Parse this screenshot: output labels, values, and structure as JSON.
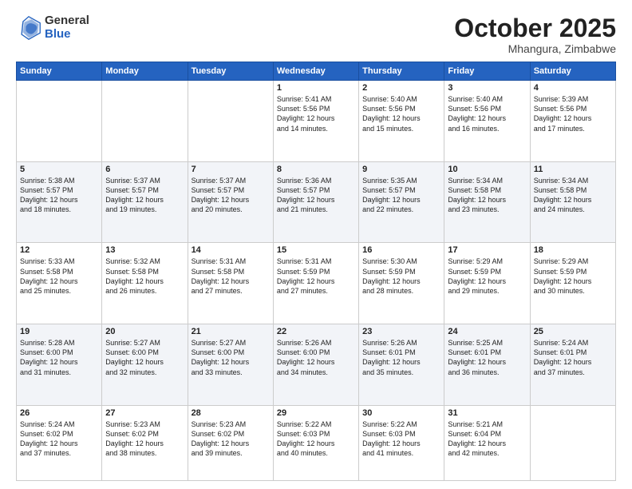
{
  "logo": {
    "general": "General",
    "blue": "Blue"
  },
  "header": {
    "month": "October 2025",
    "location": "Mhangura, Zimbabwe"
  },
  "weekdays": [
    "Sunday",
    "Monday",
    "Tuesday",
    "Wednesday",
    "Thursday",
    "Friday",
    "Saturday"
  ],
  "weeks": [
    [
      {
        "day": "",
        "text": ""
      },
      {
        "day": "",
        "text": ""
      },
      {
        "day": "",
        "text": ""
      },
      {
        "day": "1",
        "text": "Sunrise: 5:41 AM\nSunset: 5:56 PM\nDaylight: 12 hours\nand 14 minutes."
      },
      {
        "day": "2",
        "text": "Sunrise: 5:40 AM\nSunset: 5:56 PM\nDaylight: 12 hours\nand 15 minutes."
      },
      {
        "day": "3",
        "text": "Sunrise: 5:40 AM\nSunset: 5:56 PM\nDaylight: 12 hours\nand 16 minutes."
      },
      {
        "day": "4",
        "text": "Sunrise: 5:39 AM\nSunset: 5:56 PM\nDaylight: 12 hours\nand 17 minutes."
      }
    ],
    [
      {
        "day": "5",
        "text": "Sunrise: 5:38 AM\nSunset: 5:57 PM\nDaylight: 12 hours\nand 18 minutes."
      },
      {
        "day": "6",
        "text": "Sunrise: 5:37 AM\nSunset: 5:57 PM\nDaylight: 12 hours\nand 19 minutes."
      },
      {
        "day": "7",
        "text": "Sunrise: 5:37 AM\nSunset: 5:57 PM\nDaylight: 12 hours\nand 20 minutes."
      },
      {
        "day": "8",
        "text": "Sunrise: 5:36 AM\nSunset: 5:57 PM\nDaylight: 12 hours\nand 21 minutes."
      },
      {
        "day": "9",
        "text": "Sunrise: 5:35 AM\nSunset: 5:57 PM\nDaylight: 12 hours\nand 22 minutes."
      },
      {
        "day": "10",
        "text": "Sunrise: 5:34 AM\nSunset: 5:58 PM\nDaylight: 12 hours\nand 23 minutes."
      },
      {
        "day": "11",
        "text": "Sunrise: 5:34 AM\nSunset: 5:58 PM\nDaylight: 12 hours\nand 24 minutes."
      }
    ],
    [
      {
        "day": "12",
        "text": "Sunrise: 5:33 AM\nSunset: 5:58 PM\nDaylight: 12 hours\nand 25 minutes."
      },
      {
        "day": "13",
        "text": "Sunrise: 5:32 AM\nSunset: 5:58 PM\nDaylight: 12 hours\nand 26 minutes."
      },
      {
        "day": "14",
        "text": "Sunrise: 5:31 AM\nSunset: 5:58 PM\nDaylight: 12 hours\nand 27 minutes."
      },
      {
        "day": "15",
        "text": "Sunrise: 5:31 AM\nSunset: 5:59 PM\nDaylight: 12 hours\nand 27 minutes."
      },
      {
        "day": "16",
        "text": "Sunrise: 5:30 AM\nSunset: 5:59 PM\nDaylight: 12 hours\nand 28 minutes."
      },
      {
        "day": "17",
        "text": "Sunrise: 5:29 AM\nSunset: 5:59 PM\nDaylight: 12 hours\nand 29 minutes."
      },
      {
        "day": "18",
        "text": "Sunrise: 5:29 AM\nSunset: 5:59 PM\nDaylight: 12 hours\nand 30 minutes."
      }
    ],
    [
      {
        "day": "19",
        "text": "Sunrise: 5:28 AM\nSunset: 6:00 PM\nDaylight: 12 hours\nand 31 minutes."
      },
      {
        "day": "20",
        "text": "Sunrise: 5:27 AM\nSunset: 6:00 PM\nDaylight: 12 hours\nand 32 minutes."
      },
      {
        "day": "21",
        "text": "Sunrise: 5:27 AM\nSunset: 6:00 PM\nDaylight: 12 hours\nand 33 minutes."
      },
      {
        "day": "22",
        "text": "Sunrise: 5:26 AM\nSunset: 6:00 PM\nDaylight: 12 hours\nand 34 minutes."
      },
      {
        "day": "23",
        "text": "Sunrise: 5:26 AM\nSunset: 6:01 PM\nDaylight: 12 hours\nand 35 minutes."
      },
      {
        "day": "24",
        "text": "Sunrise: 5:25 AM\nSunset: 6:01 PM\nDaylight: 12 hours\nand 36 minutes."
      },
      {
        "day": "25",
        "text": "Sunrise: 5:24 AM\nSunset: 6:01 PM\nDaylight: 12 hours\nand 37 minutes."
      }
    ],
    [
      {
        "day": "26",
        "text": "Sunrise: 5:24 AM\nSunset: 6:02 PM\nDaylight: 12 hours\nand 37 minutes."
      },
      {
        "day": "27",
        "text": "Sunrise: 5:23 AM\nSunset: 6:02 PM\nDaylight: 12 hours\nand 38 minutes."
      },
      {
        "day": "28",
        "text": "Sunrise: 5:23 AM\nSunset: 6:02 PM\nDaylight: 12 hours\nand 39 minutes."
      },
      {
        "day": "29",
        "text": "Sunrise: 5:22 AM\nSunset: 6:03 PM\nDaylight: 12 hours\nand 40 minutes."
      },
      {
        "day": "30",
        "text": "Sunrise: 5:22 AM\nSunset: 6:03 PM\nDaylight: 12 hours\nand 41 minutes."
      },
      {
        "day": "31",
        "text": "Sunrise: 5:21 AM\nSunset: 6:04 PM\nDaylight: 12 hours\nand 42 minutes."
      },
      {
        "day": "",
        "text": ""
      }
    ]
  ]
}
